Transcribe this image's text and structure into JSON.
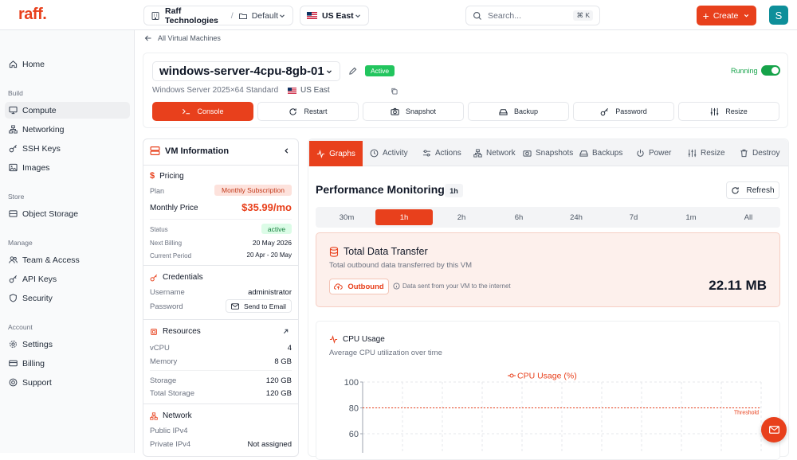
{
  "brand": {
    "logo": "raff.",
    "accent": "#e8401c"
  },
  "topbar": {
    "org": "Raff Technologies",
    "project": "Default",
    "region": "US East",
    "search_placeholder": "Search...",
    "shortcut": "⌘ K",
    "create_label": "Create",
    "avatar_initial": "S"
  },
  "sidebar": {
    "home": "Home",
    "sections": {
      "build": "Build",
      "store": "Store",
      "manage": "Manage",
      "account": "Account"
    },
    "items": {
      "compute": "Compute",
      "networking": "Networking",
      "ssh_keys": "SSH Keys",
      "images": "Images",
      "object_storage": "Object Storage",
      "team": "Team & Access",
      "api_keys": "API Keys",
      "security": "Security",
      "settings": "Settings",
      "billing": "Billing",
      "support": "Support"
    }
  },
  "breadcrumb": {
    "back_label": "All Virtual Machines"
  },
  "vm": {
    "name": "windows-server-4cpu-8gb-01",
    "status_badge": "Active",
    "os": "Windows Server 2025×64 Standard",
    "region": "US East",
    "running_label": "Running",
    "running": true
  },
  "actions": {
    "console": "Console",
    "restart": "Restart",
    "snapshot": "Snapshot",
    "backup": "Backup",
    "password": "Password",
    "resize": "Resize"
  },
  "info_panel": {
    "title": "VM Information",
    "pricing": {
      "title": "Pricing",
      "plan_label": "Plan",
      "plan_value": "Monthly Subscription",
      "monthly_price_label": "Monthly Price",
      "monthly_price_value": "$35.99/mo",
      "status_label": "Status",
      "status_value": "active",
      "next_billing_label": "Next Billing",
      "next_billing_value": "20 May 2026",
      "current_period_label": "Current Period",
      "current_period_value": "20 Apr - 20 May"
    },
    "credentials": {
      "title": "Credentials",
      "username_label": "Username",
      "username_value": "administrator",
      "password_label": "Password",
      "send_email_label": "Send to Email"
    },
    "resources": {
      "title": "Resources",
      "vcpu_label": "vCPU",
      "vcpu_value": "4",
      "memory_label": "Memory",
      "memory_value": "8 GB",
      "storage_label": "Storage",
      "storage_value": "120 GB",
      "total_storage_label": "Total Storage",
      "total_storage_value": "120 GB"
    },
    "network": {
      "title": "Network",
      "public_ipv4_label": "Public IPv4",
      "public_ipv4_value": "",
      "private_ipv4_label": "Private IPv4",
      "private_ipv4_value": "Not assigned"
    }
  },
  "tabs": {
    "graphs": "Graphs",
    "activity": "Activity",
    "actions": "Actions",
    "network": "Network",
    "snapshots": "Snapshots",
    "backups": "Backups",
    "power": "Power",
    "resize": "Resize",
    "destroy": "Destroy"
  },
  "monitoring": {
    "title": "Performance Monitoring",
    "range_badge": "1h",
    "refresh_label": "Refresh",
    "ranges": [
      "30m",
      "1h",
      "2h",
      "6h",
      "24h",
      "7d",
      "1m",
      "All"
    ],
    "selected_range": "1h"
  },
  "transfer": {
    "title": "Total Data Transfer",
    "subtitle": "Total outbound data transferred by this VM",
    "outbound_label": "Outbound",
    "hint": "Data sent from your VM to the internet",
    "value": "22.11 MB"
  },
  "cpu": {
    "title": "CPU Usage",
    "subtitle": "Average CPU utilization over time"
  },
  "chart_data": {
    "type": "line",
    "series": [
      {
        "name": "CPU Usage (%)",
        "values": []
      }
    ],
    "y_ticks": [
      "100",
      "80",
      "60"
    ],
    "threshold": {
      "label": "Threshold",
      "value": 80
    },
    "grid": true,
    "legend": "top-center"
  }
}
